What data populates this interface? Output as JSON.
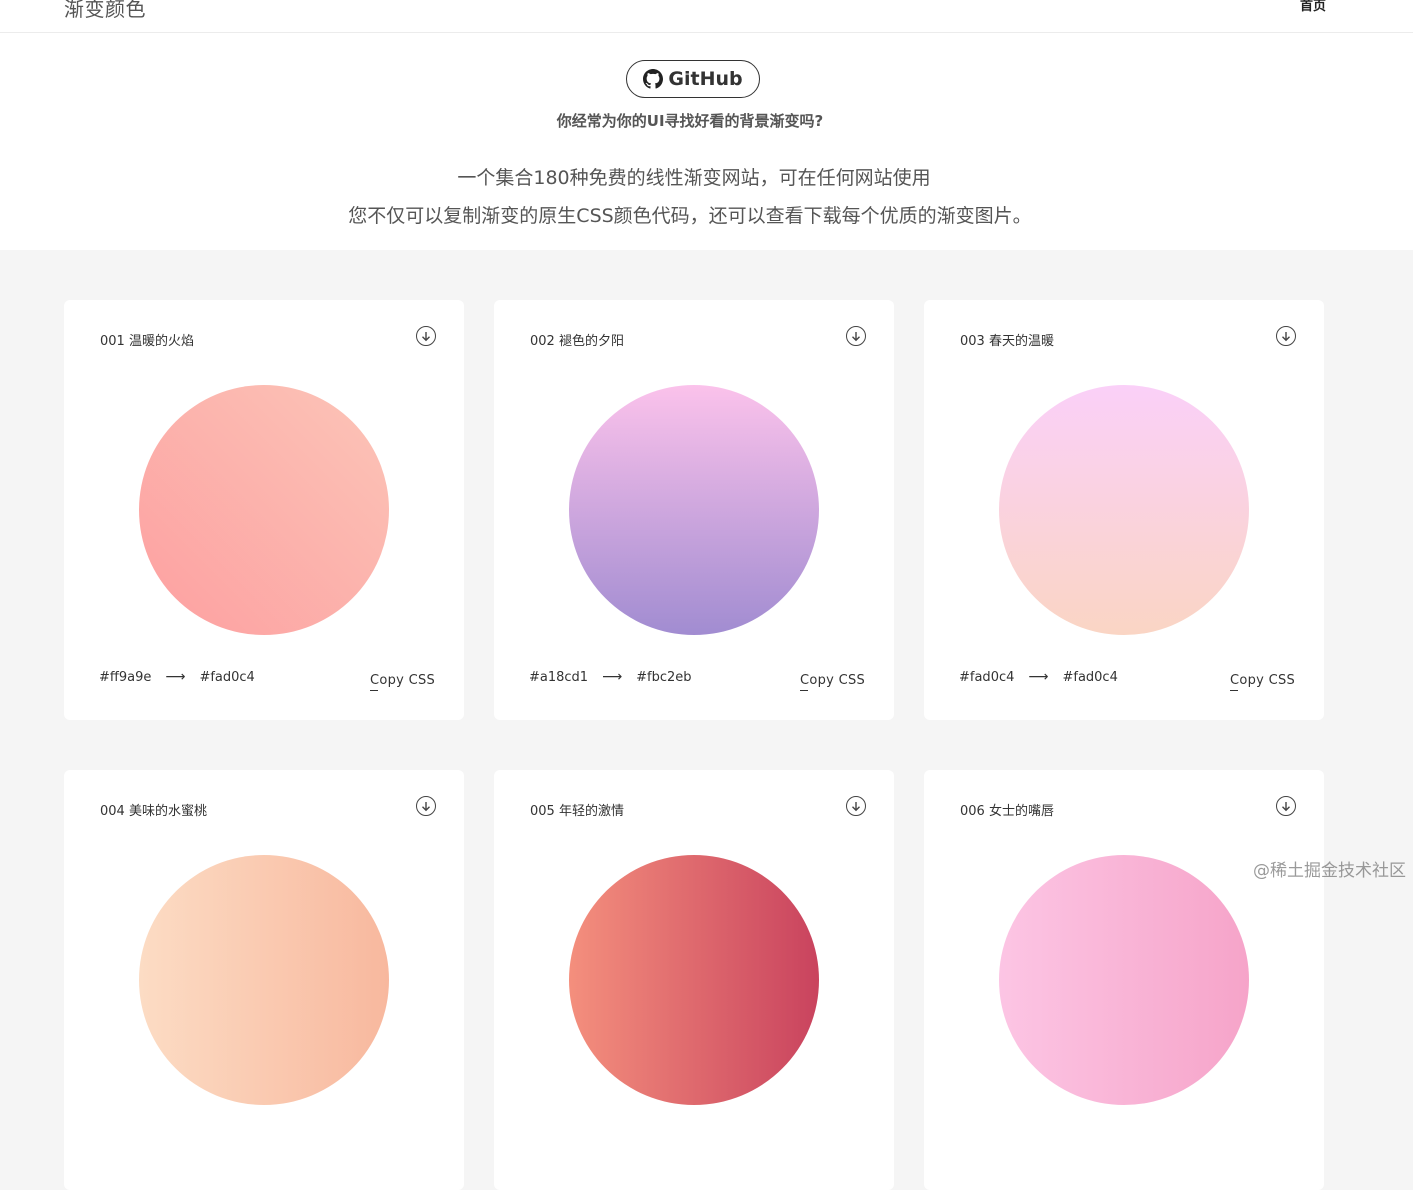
{
  "header": {
    "site_title": "渐变颜色",
    "nav_home": "首页"
  },
  "hero": {
    "github_label": "GitHub",
    "question": "你经常为你的UI寻找好看的背景渐变吗?",
    "line1": "一个集合180种免费的线性渐变网站，可在任何网站使用",
    "line2": "您不仅可以复制渐变的原生CSS颜色代码，还可以查看下载每个优质的渐变图片。"
  },
  "cards": [
    {
      "title": "001 温暖的火焰",
      "color_from": "#ff9a9e",
      "color_to": "#fad0c4",
      "copy_label": "Copy CSS",
      "grad_top": "#fcc5b8",
      "grad_bottom": "#fd9fa0",
      "angle": "45deg"
    },
    {
      "title": "002 褪色的夕阳",
      "color_from": "#a18cd1",
      "color_to": "#fbc2eb",
      "copy_label": "Copy CSS",
      "grad_top": "#fbc2eb",
      "grad_bottom": "#a18cd1",
      "angle": "180deg"
    },
    {
      "title": "003 春天的温暖",
      "color_from": "#fad0c4",
      "color_to": "#fad0c4",
      "copy_label": "Copy CSS",
      "grad_top": "#fad0f8",
      "grad_bottom": "#fad5c4",
      "angle": "180deg"
    },
    {
      "title": "004 美味的水蜜桃",
      "grad_top": "#fcdcc4",
      "grad_bottom": "#f8b89e",
      "angle": "90deg"
    },
    {
      "title": "005 年轻的激情",
      "grad_top": "#f48f7d",
      "grad_bottom": "#c9435e",
      "angle": "90deg"
    },
    {
      "title": "006 女士的嘴唇",
      "grad_top": "#fcc5e4",
      "grad_bottom": "#f6a4c9",
      "angle": "90deg"
    }
  ],
  "watermark": "@稀土掘金技术社区"
}
